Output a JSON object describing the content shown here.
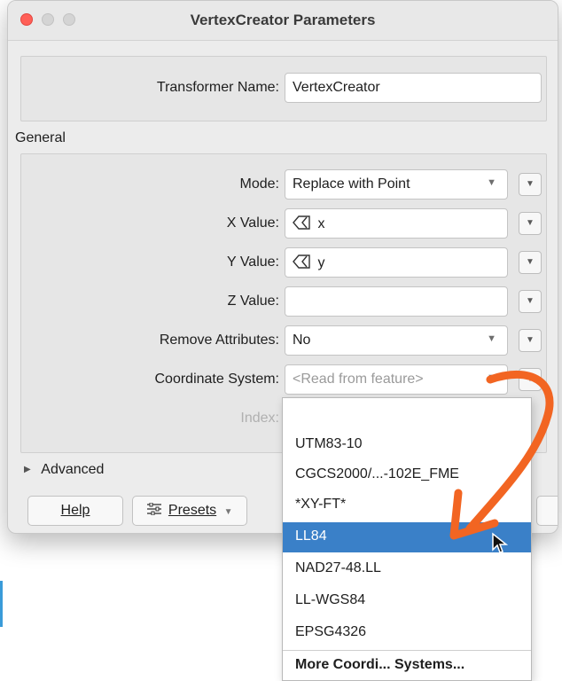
{
  "window": {
    "title": "VertexCreator Parameters"
  },
  "transformer_name": {
    "label": "Transformer Name:",
    "value": "VertexCreator"
  },
  "general": {
    "section_label": "General",
    "mode": {
      "label": "Mode:",
      "value": "Replace with Point"
    },
    "x_value": {
      "label": "X Value:",
      "value": "x"
    },
    "y_value": {
      "label": "Y Value:",
      "value": "y"
    },
    "z_value": {
      "label": "Z Value:",
      "value": ""
    },
    "remove_attributes": {
      "label": "Remove Attributes:",
      "value": "No"
    },
    "coordinate_system": {
      "label": "Coordinate System:",
      "placeholder": "<Read from feature>"
    },
    "index": {
      "label": "Index:"
    }
  },
  "advanced": {
    "label": "Advanced"
  },
  "buttons": {
    "help": "Help",
    "presets": "Presets"
  },
  "dropdown": {
    "options": [
      "",
      "UTM83-10",
      "CGCS2000/...-102E_FME",
      "*XY-FT*",
      "LL84",
      "NAD27-48.LL",
      "LL-WGS84",
      "EPSG4326",
      "More Coordi... Systems..."
    ],
    "selected": "LL84"
  },
  "annotation": {
    "arrow_color": "#f26522"
  },
  "colors": {
    "selection": "#3a80c8",
    "close_button": "#ff5f57"
  }
}
